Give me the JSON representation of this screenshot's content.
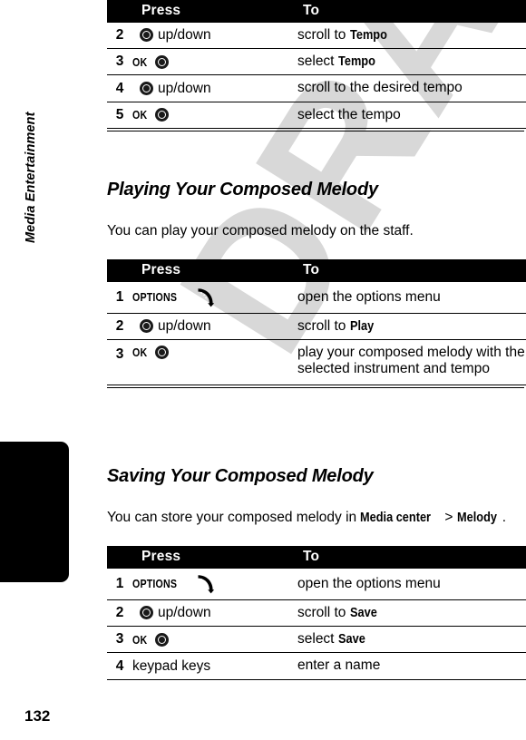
{
  "page": {
    "number": "132",
    "chapter": "Media Entertainment",
    "watermark": "DRAFT"
  },
  "table_headers": {
    "press": "Press",
    "to": "To"
  },
  "sections": [
    {
      "id": "setting-tempo-continued",
      "heading": null,
      "intro": null,
      "rows": [
        {
          "num": "2",
          "press_key": null,
          "press_icon": "nav-key-icon",
          "press_text": "up/down",
          "icon_first": true,
          "to_text": "scroll to ",
          "to_bold": "Tempo"
        },
        {
          "num": "3",
          "press_key": "OK",
          "press_icon": "nav-key-icon",
          "press_text": null,
          "icon_first": false,
          "to_text": "select ",
          "to_bold": "Tempo"
        },
        {
          "num": "4",
          "press_key": null,
          "press_icon": "nav-key-icon",
          "press_text": "up/down",
          "icon_first": true,
          "to_text": "scroll to the desired tempo",
          "to_bold": null
        },
        {
          "num": "5",
          "press_key": "OK",
          "press_icon": "nav-key-icon",
          "press_text": null,
          "icon_first": false,
          "to_text": "select the tempo",
          "to_bold": null
        }
      ]
    },
    {
      "id": "playing-your-composed-melody",
      "heading": "Playing Your Composed Melody",
      "intro": "You can play your composed melody on the staff.",
      "rows": [
        {
          "num": "1",
          "press_key": "OPTIONS",
          "press_icon": "soft-key-icon",
          "press_text": null,
          "icon_first": false,
          "to_text": "open the options menu",
          "to_bold": null
        },
        {
          "num": "2",
          "press_key": null,
          "press_icon": "nav-key-icon",
          "press_text": "up/down",
          "icon_first": true,
          "to_text": "scroll to ",
          "to_bold": "Play"
        },
        {
          "num": "3",
          "press_key": "OK",
          "press_icon": "nav-key-icon",
          "press_text": null,
          "icon_first": false,
          "to_text": "play your composed melody with the selected instrument and tempo",
          "to_bold": null
        }
      ]
    },
    {
      "id": "saving-your-composed-melody",
      "heading": "Saving Your Composed Melody",
      "intro_pre": "You can store your composed melody in ",
      "intro_bold1": "Media center",
      "intro_mid": " > ",
      "intro_bold2": "Melody",
      "intro_post": ".",
      "rows": [
        {
          "num": "1",
          "press_key": "OPTIONS",
          "press_icon": "soft-key-icon",
          "press_text": null,
          "icon_first": false,
          "to_text": "open the options menu",
          "to_bold": null
        },
        {
          "num": "2",
          "press_key": null,
          "press_icon": "nav-key-icon",
          "press_text": "up/down",
          "icon_first": true,
          "to_text": "scroll to ",
          "to_bold": "Save"
        },
        {
          "num": "3",
          "press_key": "OK",
          "press_icon": "nav-key-icon",
          "press_text": null,
          "icon_first": false,
          "to_text": "select ",
          "to_bold": "Save"
        },
        {
          "num": "4",
          "press_key": null,
          "press_icon": null,
          "press_text": "keypad keys",
          "icon_first": false,
          "to_text": "enter a name",
          "to_bold": null
        }
      ]
    }
  ]
}
